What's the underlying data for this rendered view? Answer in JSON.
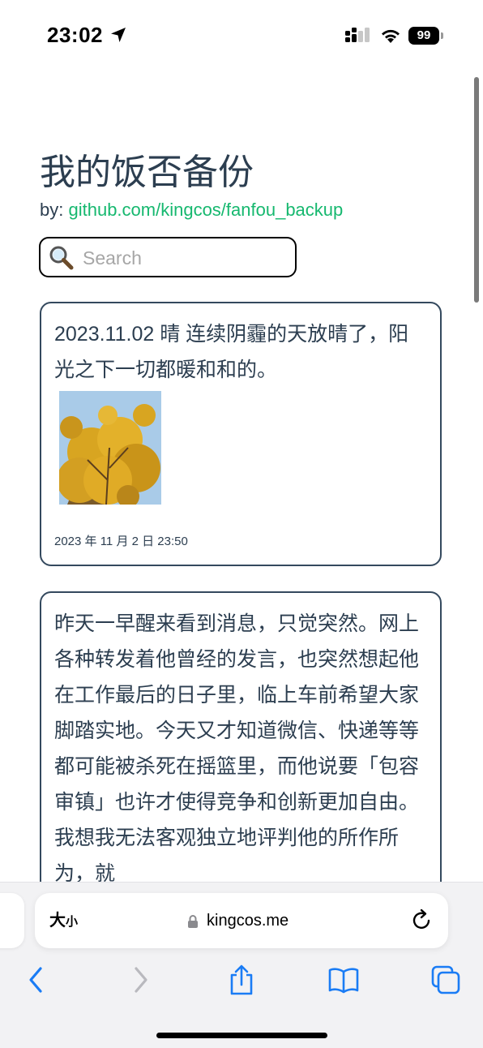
{
  "status_bar": {
    "time": "23:02",
    "battery": "99"
  },
  "page": {
    "title": "我的饭否备份",
    "byline_prefix": "by:",
    "byline_link": "github.com/kingcos/fanfou_backup"
  },
  "search": {
    "placeholder": "Search"
  },
  "posts": [
    {
      "text": "2023.11.02 晴 连续阴霾的天放晴了，阳光之下一切都暖和和的。",
      "photo": "yellow-autumn-tree-photo",
      "date": "2023 年 11 月 2 日 23:50"
    },
    {
      "text": "昨天一早醒来看到消息，只觉突然。网上各种转发着他曾经的发言，也突然想起他在工作最后的日子里，临上车前希望大家脚踏实地。今天又才知道微信、快递等等都可能被杀死在摇篮里，而他说要「包容审镇」也许才使得竞争和创新更加自由。我想我无法客观独立地评判他的所作所为，就"
    }
  ],
  "browser": {
    "text_size_label": "大",
    "text_size_small": "小",
    "domain": "kingcos.me"
  },
  "colors": {
    "link": "#16b86f",
    "text": "#2c3e50",
    "ios_blue": "#1a7cf5"
  }
}
